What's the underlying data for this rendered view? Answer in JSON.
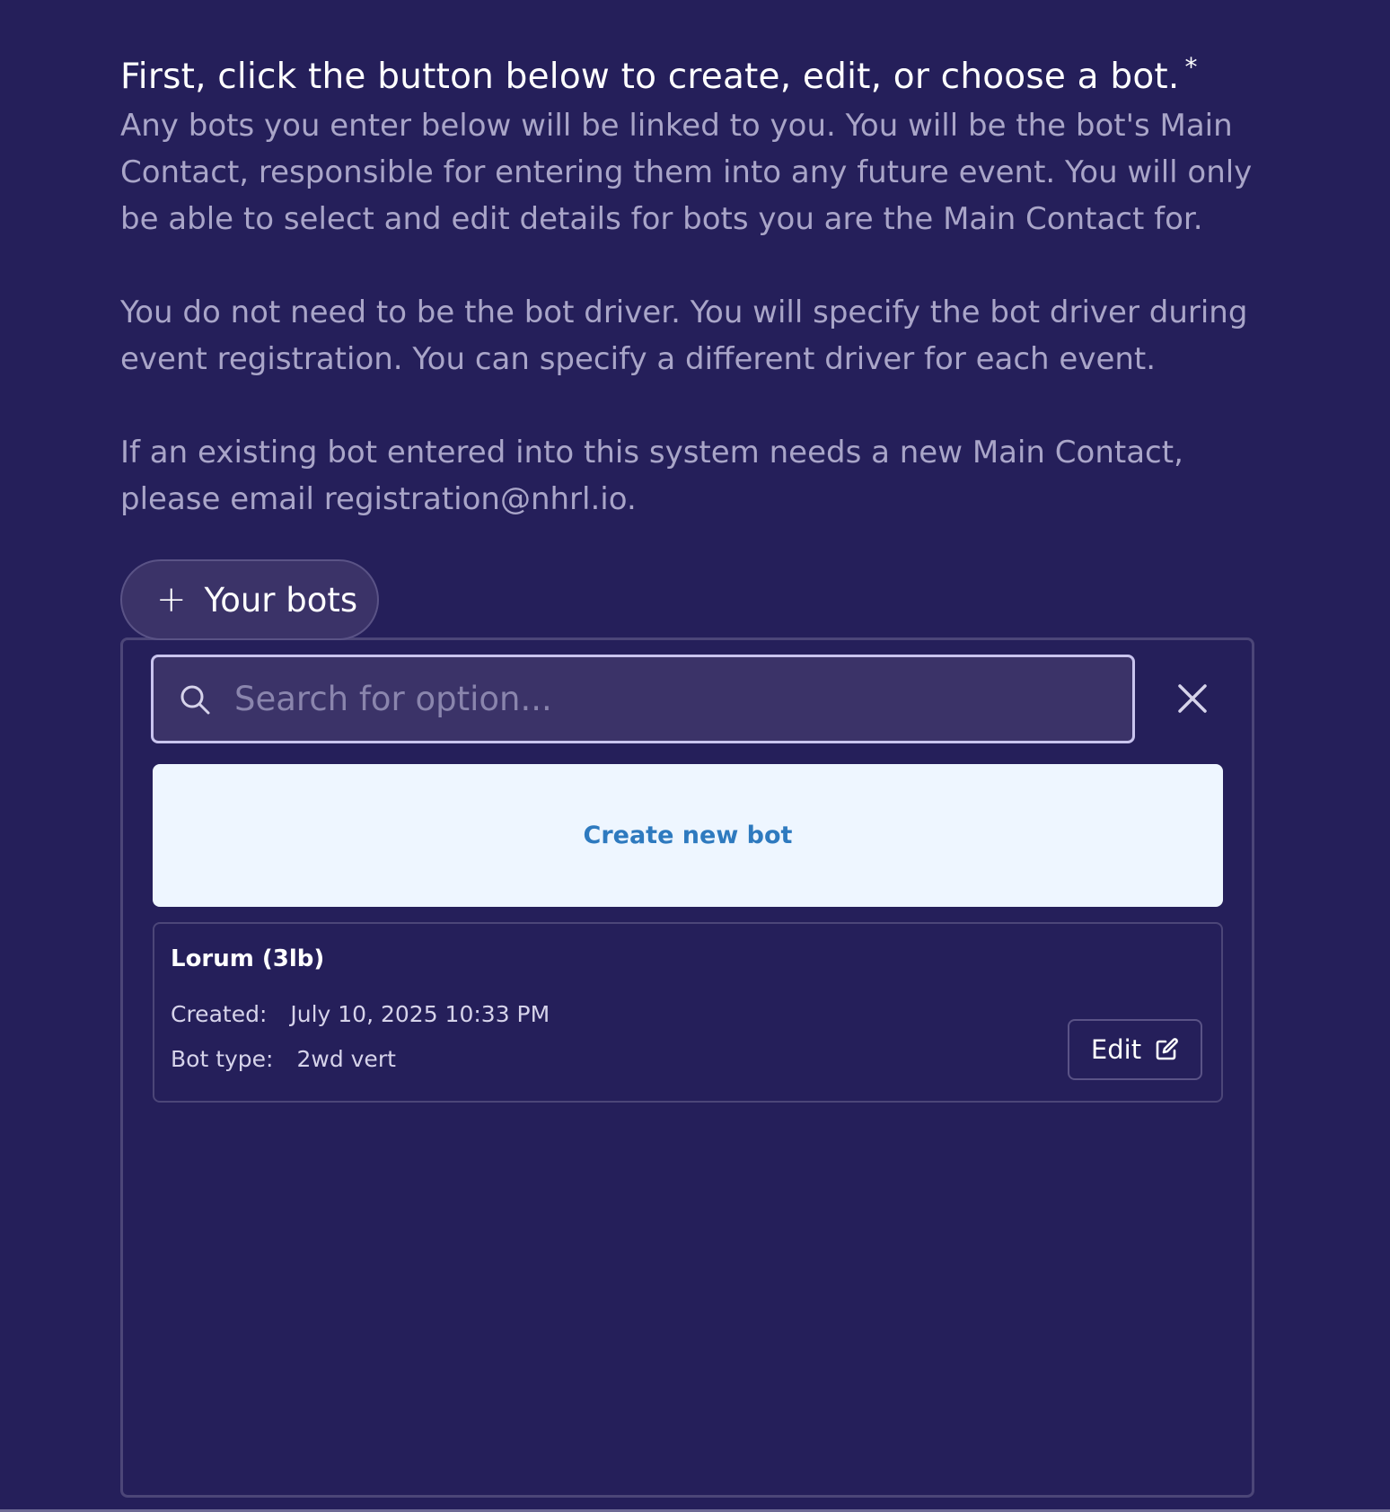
{
  "question": {
    "title": "First, click the button below to create, edit, or choose a bot.",
    "required_marker": "*",
    "paragraphs": [
      "Any bots you enter below will be linked to you. You will be the bot's Main Contact, responsible for entering them into any future event. You will only be able to select and edit details for bots you are the Main Contact for.",
      "You do not need to be the bot driver. You will specify the bot driver during event registration. You can specify a different driver for each event.",
      "If an existing bot entered into this system needs a new Main Contact, please email registration@nhrl.io."
    ]
  },
  "dropdown": {
    "toggle_label": "Your bots",
    "toggle_icon": "plus-icon",
    "search": {
      "placeholder": "Search for option...",
      "value": "",
      "icon": "search-icon"
    },
    "close_icon": "close-icon",
    "create_label": "Create new bot",
    "bots": [
      {
        "name": "Lorum (3lb)",
        "created_label": "Created:",
        "created_value": "July 10, 2025 10:33 PM",
        "type_label": "Bot type:",
        "type_value": "2wd vert",
        "edit_label": "Edit",
        "edit_icon": "external-edit-icon"
      }
    ]
  },
  "colors": {
    "background": "#251f5a",
    "panel_border": "#4c4678",
    "muted_text": "#a9a5c8",
    "create_bg": "#eef6ff",
    "create_text": "#2e7abf"
  }
}
